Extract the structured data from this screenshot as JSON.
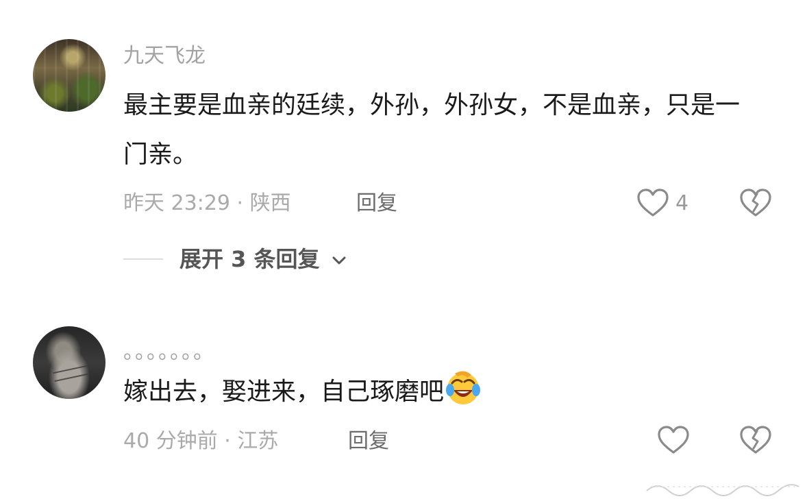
{
  "comments": [
    {
      "username": "九天飞龙",
      "text": "最主要是血亲的廷续，外孙，外孙女，不是血亲，只是一门亲。",
      "meta": "昨天 23:29 · 陕西",
      "reply_label": "回复",
      "like_count": "4",
      "expand_label": "展开 3 条回复"
    },
    {
      "username": "。。。。。。。",
      "text": "嫁出去，娶进来，自己琢磨吧",
      "meta": "40 分钟前 · 江苏",
      "reply_label": "回复"
    }
  ],
  "icons": {
    "like": "heart-outline-icon",
    "dislike": "broken-heart-icon",
    "expand": "chevron-down-icon",
    "emoji": "laughing-crying-emoji"
  },
  "colors": {
    "text": "#1a1a1a",
    "username": "#a3a3a3",
    "meta": "#aaaaaa",
    "icon": "#8a8a8a"
  }
}
